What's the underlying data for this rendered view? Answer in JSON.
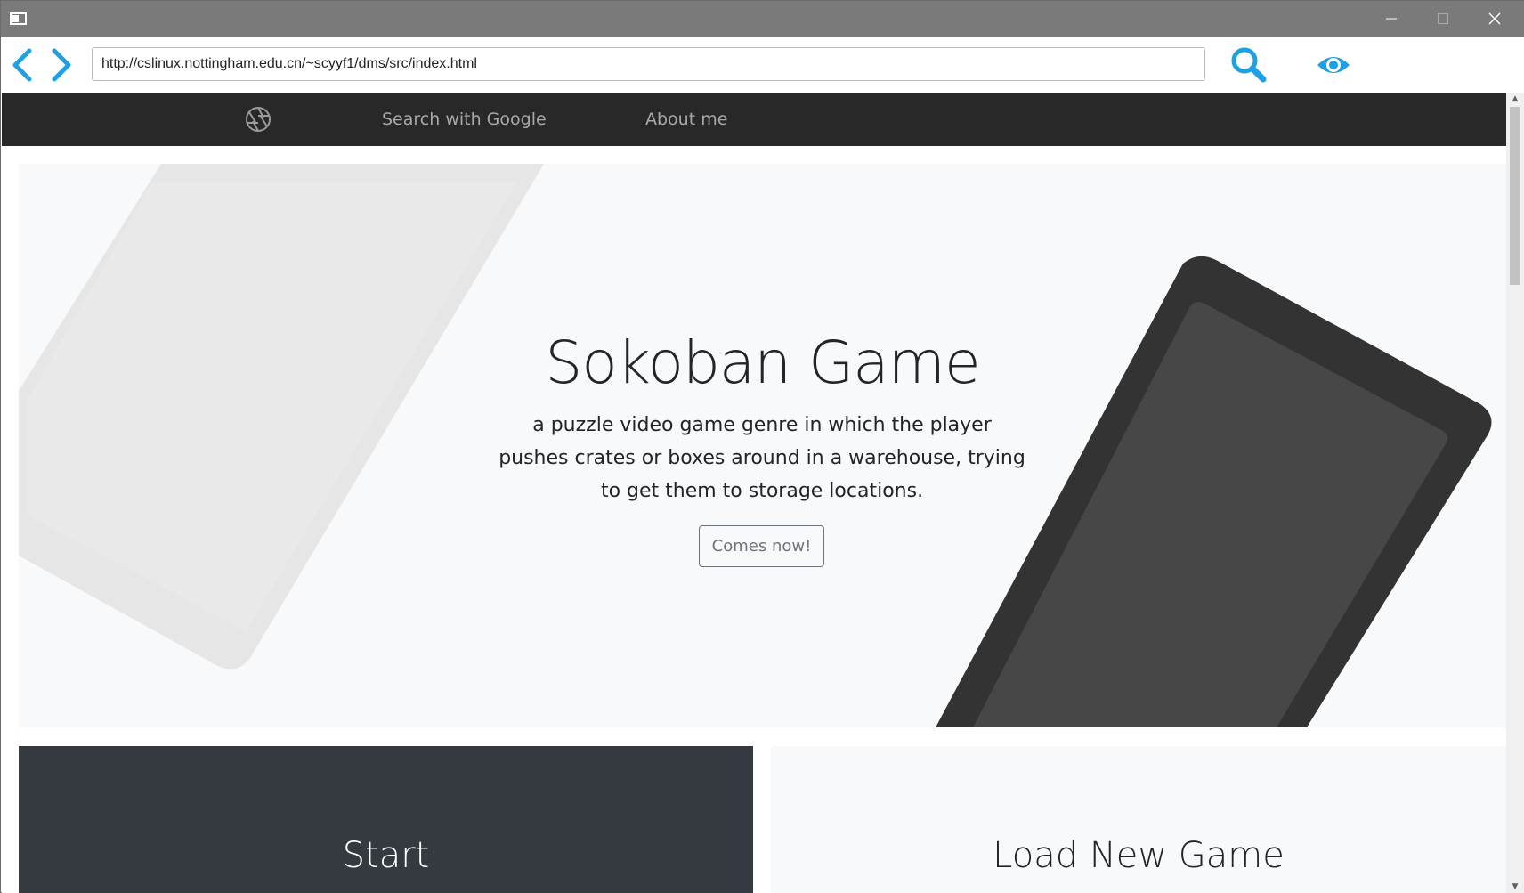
{
  "window": {
    "controls": {
      "minimize": "minimize-icon",
      "maximize": "maximize-icon",
      "close": "close-icon"
    }
  },
  "toolbar": {
    "back_icon": "chevron-left-icon",
    "forward_icon": "chevron-right-icon",
    "url": "http://cslinux.nottingham.edu.cn/~scyyf1/dms/src/index.html",
    "search_icon": "search-icon",
    "view_icon": "eye-icon",
    "accent_color": "#1fa0e0"
  },
  "site_nav": {
    "brand_icon": "aperture-icon",
    "links": [
      {
        "label": "Search with Google"
      },
      {
        "label": "About me"
      }
    ],
    "background": "#282828"
  },
  "hero": {
    "title": "Sokoban Game",
    "description": "a puzzle video game genre in which the player pushes crates or boxes around in a warehouse, trying to get them to storage locations.",
    "button_label": "Comes now!",
    "background": "#f8f9fa"
  },
  "cards": [
    {
      "title": "Start",
      "background": "#343a40"
    },
    {
      "title": "Load New Game",
      "background": "#f8f9fa"
    }
  ]
}
